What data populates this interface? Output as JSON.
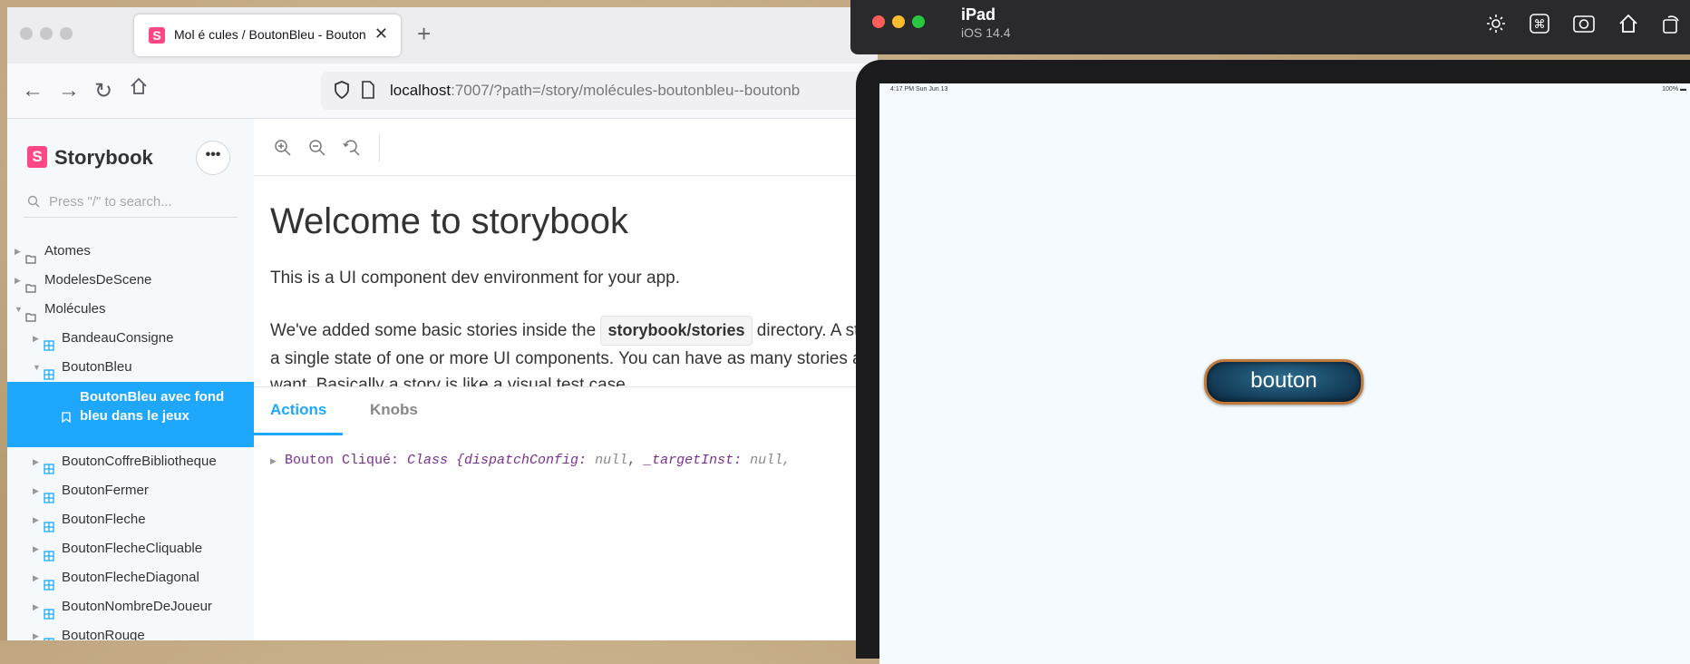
{
  "browser": {
    "tab_title": "Mol é cules / BoutonBleu - Bouton",
    "url_host": "localhost",
    "url_rest": ":7007/?path=/story/molécules-boutonbleu--boutonb"
  },
  "sidebar": {
    "logo": "Storybook",
    "menu_label": "•••",
    "search_placeholder": "Press \"/\" to search...",
    "items": [
      {
        "label": "Atomes"
      },
      {
        "label": "ModelesDeScene"
      },
      {
        "label": "Molécules"
      },
      {
        "label": "BandeauConsigne"
      },
      {
        "label": "BoutonBleu"
      },
      {
        "label": "BoutonBleu avec fond bleu dans le jeux"
      },
      {
        "label": "BoutonCoffreBibliotheque"
      },
      {
        "label": "BoutonFermer"
      },
      {
        "label": "BoutonFleche"
      },
      {
        "label": "BoutonFlecheCliquable"
      },
      {
        "label": "BoutonFlecheDiagonal"
      },
      {
        "label": "BoutonNombreDeJoueur"
      },
      {
        "label": "BoutonRouge"
      }
    ]
  },
  "preview": {
    "title": "Welcome to storybook",
    "p1": "This is a UI component dev environment for your app.",
    "p2_start": "We've added some basic stories inside the ",
    "p2_code": "storybook/stories",
    "p2_end": " directory. A story is a single state of one or more UI components. You can have as many stories as you want. Basically a story is like a visual test case."
  },
  "addons": {
    "tabs": [
      "Actions",
      "Knobs"
    ],
    "log_name": "Bouton Cliqué:",
    "log_class": "Class",
    "log_brace": "{",
    "log_key1": "dispatchConfig:",
    "log_val1": "null",
    "log_key2": "_targetInst:",
    "log_val2": "null,"
  },
  "simulator": {
    "device": "iPad",
    "os": "iOS 14.4",
    "status_time": "4:17 PM  Sun Jun 13",
    "status_battery": "100%",
    "button_label": "bouton"
  }
}
